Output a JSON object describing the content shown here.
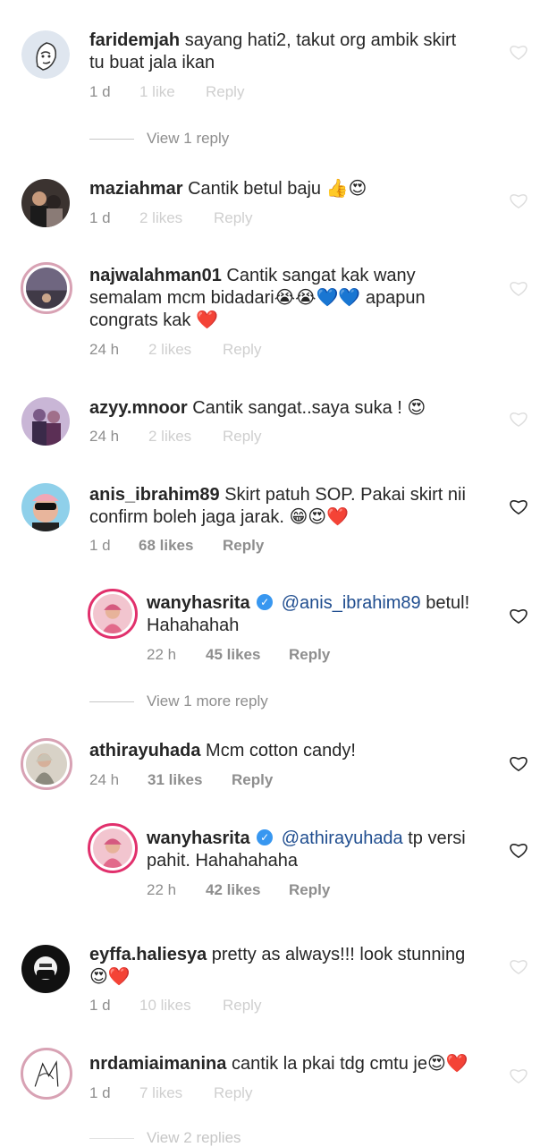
{
  "comments": [
    {
      "user": "faridemjah",
      "text": "sayang hati2, takut org ambik skirt",
      "text2": "tu buat jala ikan",
      "time": "1 d",
      "likes": "1 like",
      "reply": "Reply"
    },
    {
      "user": "maziahmar",
      "text": "Cantik betul baju 👍😍",
      "time": "1 d",
      "likes": "2 likes",
      "reply": "Reply"
    },
    {
      "user": "najwalahman01",
      "text": "Cantik sangat kak wany",
      "text2": "semalam mcm bidadari😭😭💙💙 apapun",
      "text3": "congrats kak ❤️",
      "time": "24 h",
      "likes": "2 likes",
      "reply": "Reply"
    },
    {
      "user": "azyy.mnoor",
      "text": "Cantik sangat..saya suka ! 😍",
      "time": "24 h",
      "likes": "2 likes",
      "reply": "Reply"
    },
    {
      "user": "anis_ibrahim89",
      "text": "Skirt patuh SOP. Pakai skirt nii",
      "text2": "confirm boleh jaga jarak. 😁😍❤️",
      "time": "1 d",
      "likes": "68 likes",
      "reply": "Reply"
    },
    {
      "user": "wanyhasrita",
      "mention": "@anis_ibrahim89",
      "text": "betul!",
      "text2": "Hahahahah",
      "time": "22 h",
      "likes": "45 likes",
      "reply": "Reply"
    },
    {
      "user": "athirayuhada",
      "text": "Mcm cotton candy!",
      "time": "24 h",
      "likes": "31 likes",
      "reply": "Reply"
    },
    {
      "user": "wanyhasrita",
      "mention": "@athirayuhada",
      "text": "tp versi",
      "text2": "pahit. Hahahahaha",
      "time": "22 h",
      "likes": "42 likes",
      "reply": "Reply"
    },
    {
      "user": "eyffa.haliesya",
      "text": "pretty as always!!! look stunning",
      "text2": "😍❤️",
      "time": "1 d",
      "likes": "10 likes",
      "reply": "Reply"
    },
    {
      "user": "nrdamiaimanina",
      "text": "cantik la pkai tdg cmtu je😍❤️",
      "time": "1 d",
      "likes": "7 likes",
      "reply": "Reply"
    }
  ],
  "view_replies": {
    "first": "View 1 reply",
    "second": "View 1 more reply",
    "third": "View 2 replies"
  },
  "colors": {
    "heart": "#c7c7c7",
    "verified": "#3897f0",
    "mention": "#1f4d8f"
  }
}
